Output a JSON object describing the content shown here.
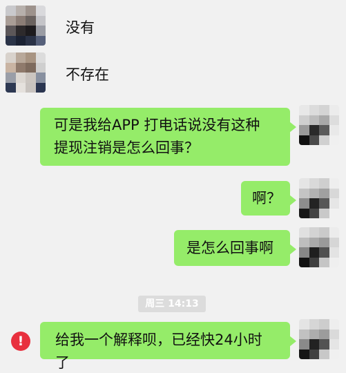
{
  "messages": [
    {
      "side": "left",
      "text": "没有"
    },
    {
      "side": "left",
      "text": "不存在"
    },
    {
      "side": "right",
      "line1": "可是我给APP 打电话说没有这种",
      "line2": "提现注销是怎么回事？"
    },
    {
      "side": "right",
      "text": "啊？"
    },
    {
      "side": "right",
      "text": "是怎么回事啊"
    },
    {
      "side": "right",
      "text": "给我一个解释呗，已经快24小时了",
      "status": "send-failed"
    }
  ],
  "timestamp": "周三 14:13",
  "error_icon": "!",
  "colors": {
    "bubble": "#95ec69",
    "background": "#f1f1f1",
    "error": "#e8303e"
  }
}
